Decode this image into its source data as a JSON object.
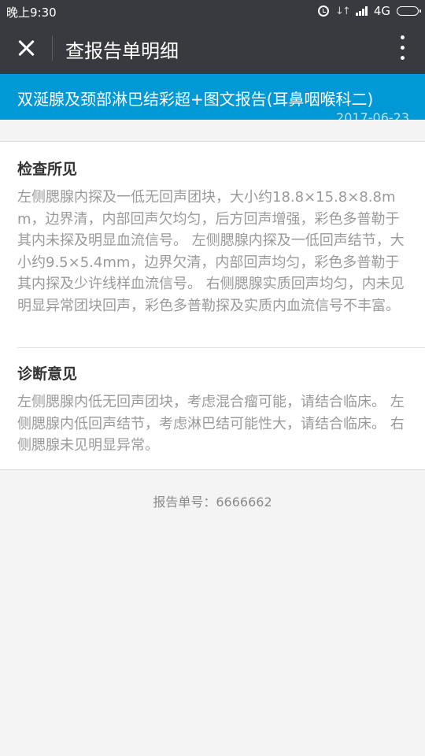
{
  "status_bar": {
    "time": "晚上9:30",
    "network": "4G",
    "icons": [
      "alarm-icon",
      "data-arrows-icon",
      "signal-icon",
      "battery-icon"
    ]
  },
  "nav": {
    "title": "查报告单明细",
    "left_icon": "close-icon",
    "right_icon": "more-vertical-icon"
  },
  "report": {
    "title": "双涎腺及颈部淋巴结彩超+图文报告(耳鼻咽喉科二)",
    "date": "2017-06-23"
  },
  "sections": {
    "findings": {
      "title": "检查所见",
      "body": "左侧腮腺内探及一低无回声团块，大小约18.8×15.8×8.8mm，边界清，内部回声欠均匀，后方回声增强，彩色多普勒于其内未探及明显血流信号。 左侧腮腺内探及一低回声结节，大小约9.5×5.4mm，边界欠清，内部回声均匀，彩色多普勒于其内探及少许线样血流信号。 右侧腮腺实质回声均匀，内未见明显异常团块回声，彩色多普勒探及实质内血流信号不丰富。"
    },
    "diagnosis": {
      "title": "诊断意见",
      "body": "左侧腮腺内低无回声团块，考虑混合瘤可能，请结合临床。 左侧腮腺内低回声结节，考虑淋巴结可能性大，请结合临床。 右侧腮腺未见明显异常。"
    }
  },
  "footer": {
    "report_number": "报告单号：6666662"
  },
  "colors": {
    "nav_background": "#393a3f",
    "header_blue": "#0099d6",
    "body_text": "#9a9a9a",
    "page_background": "#f4f4f4"
  }
}
